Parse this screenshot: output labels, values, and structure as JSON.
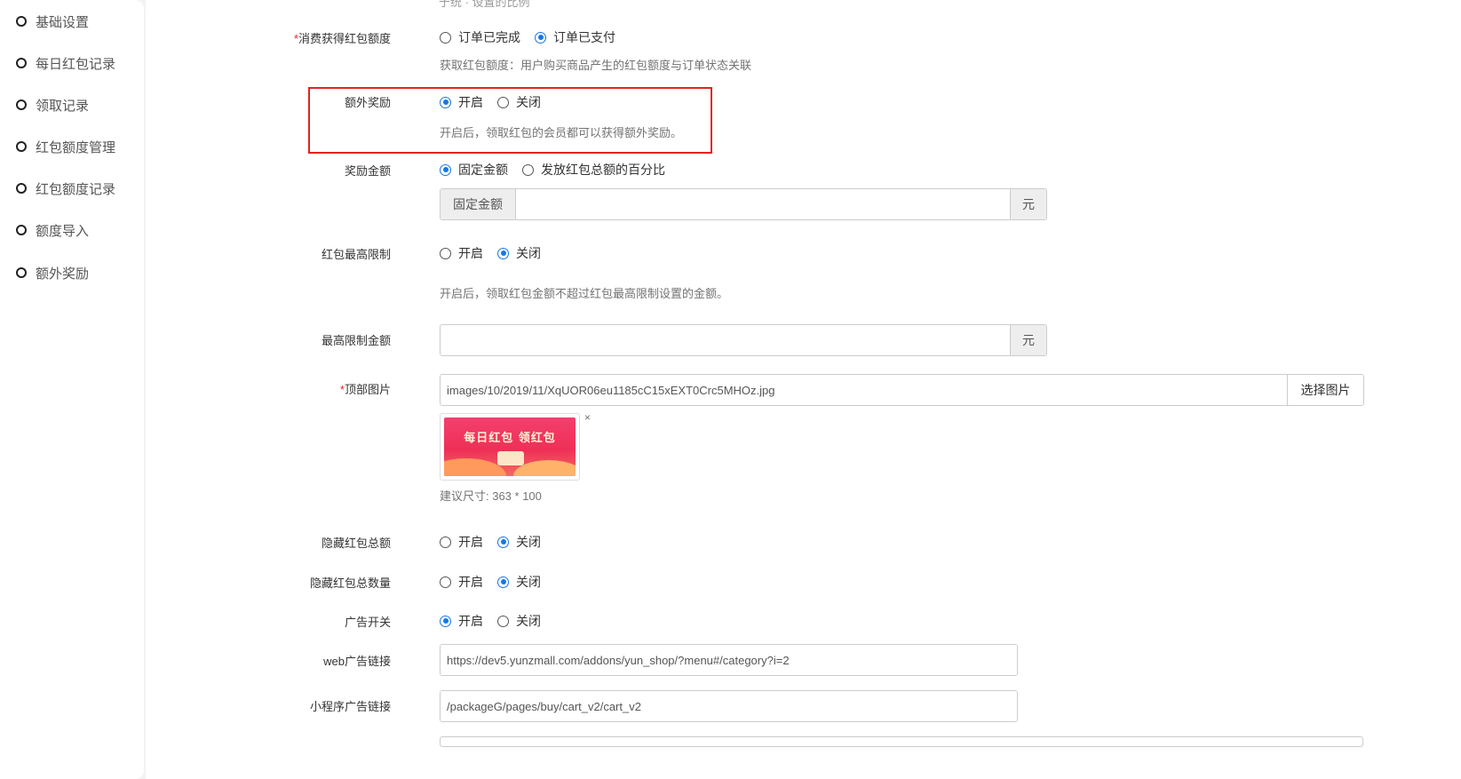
{
  "sidebar": {
    "items": [
      {
        "label": "基础设置"
      },
      {
        "label": "每日红包记录"
      },
      {
        "label": "领取记录"
      },
      {
        "label": "红包额度管理"
      },
      {
        "label": "红包额度记录"
      },
      {
        "label": "额度导入"
      },
      {
        "label": "额外奖励"
      }
    ]
  },
  "form": {
    "cut_hint": "于统 · 设置的比例",
    "consume_quota": {
      "label": "消费获得红包额度",
      "required": "*",
      "options": [
        "订单已完成",
        "订单已支付"
      ],
      "selected": "订单已支付",
      "help": "获取红包额度：用户购买商品产生的红包额度与订单状态关联"
    },
    "extra_reward": {
      "label": "额外奖励",
      "options": [
        "开启",
        "关闭"
      ],
      "selected": "开启",
      "help": "开启后，领取红包的会员都可以获得额外奖励。"
    },
    "reward_amount": {
      "label": "奖励金额",
      "options": [
        "固定金额",
        "发放红包总额的百分比"
      ],
      "selected": "固定金额",
      "prefix": "固定金额",
      "value": "",
      "suffix": "元"
    },
    "max_limit": {
      "label": "红包最高限制",
      "options": [
        "开启",
        "关闭"
      ],
      "selected": "关闭",
      "help": "开启后，领取红包金额不超过红包最高限制设置的金额。"
    },
    "max_limit_amount": {
      "label": "最高限制金额",
      "value": "",
      "suffix": "元"
    },
    "top_image": {
      "label": "顶部图片",
      "required": "*",
      "value": "images/10/2019/11/XqUOR06eu1185cC15xEXT0Crc5MHOz.jpg",
      "button": "选择图片",
      "thumb_text": "每日红包 领红包",
      "close": "×",
      "size_hint": "建议尺寸: 363 * 100"
    },
    "hide_total": {
      "label": "隐藏红包总额",
      "options": [
        "开启",
        "关闭"
      ],
      "selected": "关闭"
    },
    "hide_count": {
      "label": "隐藏红包总数量",
      "options": [
        "开启",
        "关闭"
      ],
      "selected": "关闭"
    },
    "ad_switch": {
      "label": "广告开关",
      "options": [
        "开启",
        "关闭"
      ],
      "selected": "开启"
    },
    "web_ad_link": {
      "label": "web广告链接",
      "value": "https://dev5.yunzmall.com/addons/yun_shop/?menu#/category?i=2"
    },
    "mini_ad_link": {
      "label": "小程序广告链接",
      "value": "/packageG/pages/buy/cart_v2/cart_v2"
    }
  },
  "colors": {
    "accent": "#1677e5",
    "highlight_border": "#e3231e",
    "required": "#e0262c"
  }
}
